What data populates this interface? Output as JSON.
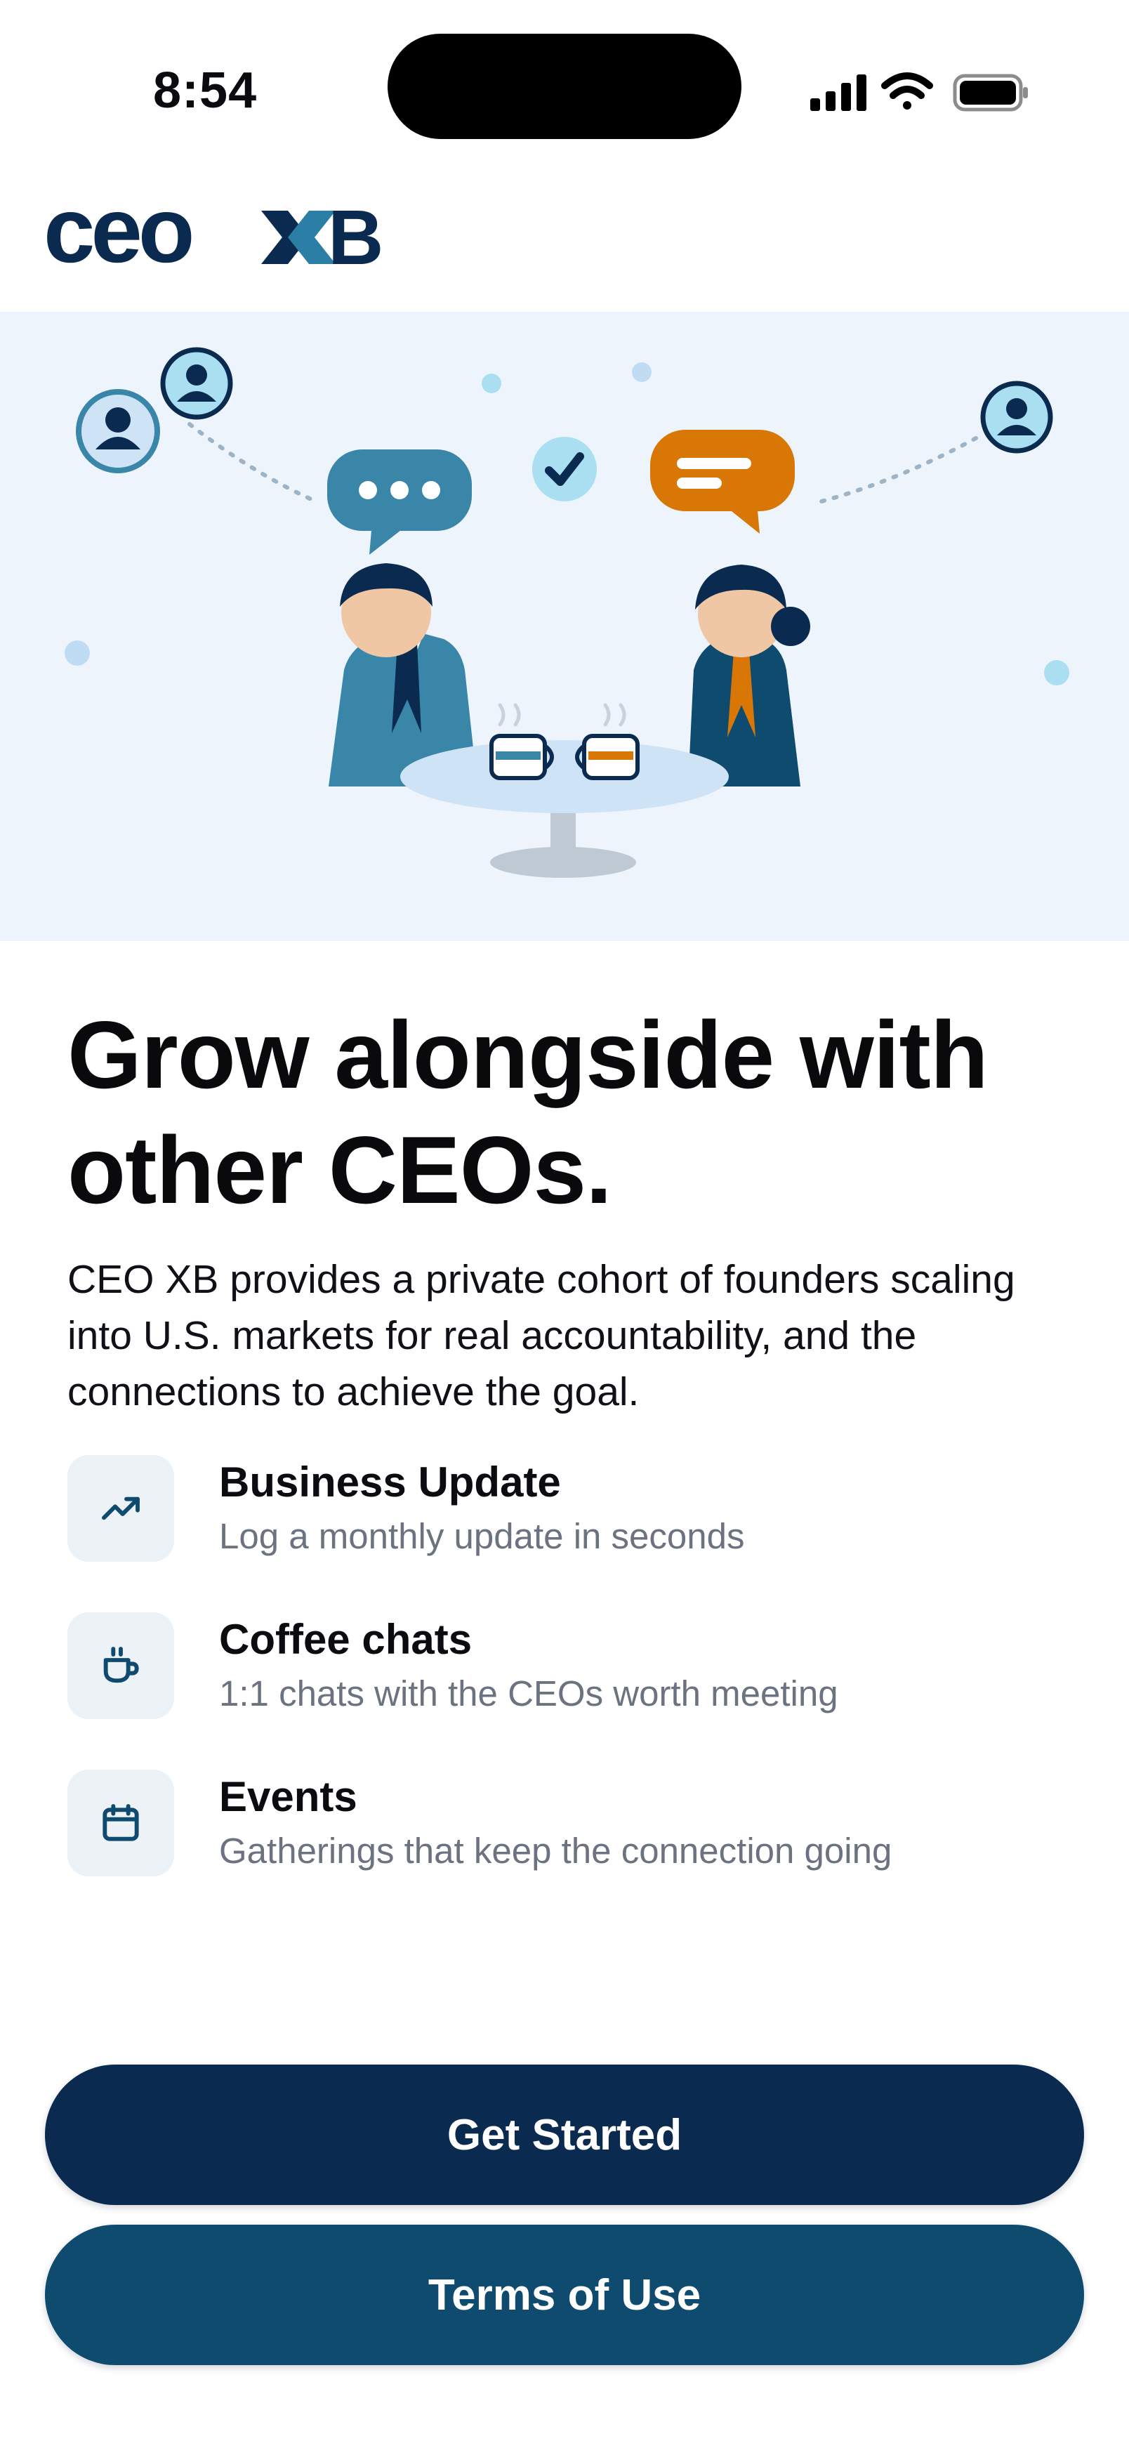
{
  "status_bar": {
    "time": "8:54"
  },
  "header": {
    "logo_text_ceo": "ceo",
    "logo_text_xb": "XB",
    "colors": {
      "dark": "#0a2b4f",
      "accent": "#2b7fa6"
    }
  },
  "hero": {
    "illustration": "two-ceos-coffee-chat"
  },
  "main": {
    "headline_line1": "Grow alongside with",
    "headline_line2": "other CEOs.",
    "intro": "CEO XB provides a private cohort of founders scaling into U.S. markets for real accountability, and the connections to achieve the goal.",
    "features": [
      {
        "icon": "trending-up-icon",
        "title": "Business Update",
        "description": "Log a monthly update in seconds"
      },
      {
        "icon": "coffee-cup-icon",
        "title": "Coffee chats",
        "description": "1:1 chats with the CEOs worth meeting"
      },
      {
        "icon": "calendar-icon",
        "title": "Events",
        "description": "Gatherings that keep the connection going"
      }
    ]
  },
  "actions": {
    "get_started": "Get Started",
    "terms": "Terms of Use"
  },
  "colors": {
    "primary_button": "#0a2b4f",
    "secondary_button": "#0f4b6f",
    "hero_background": "#edf4fc",
    "orange": "#d97706",
    "teal": "#3a86a8"
  }
}
